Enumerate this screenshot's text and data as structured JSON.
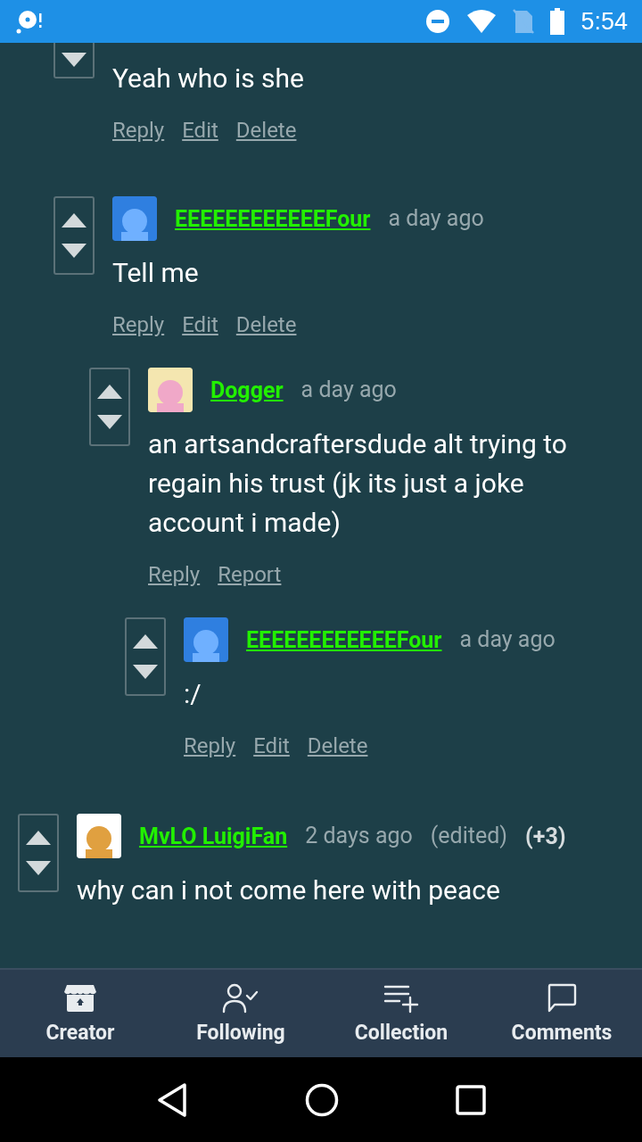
{
  "status_bar": {
    "time": "5:54"
  },
  "comments": [
    {
      "children": [
        {
          "cut_off": true,
          "body": "Yeah who is she",
          "actions": [
            "Reply",
            "Edit",
            "Delete"
          ]
        },
        {
          "author": "EEEEEEEEEEEEFour",
          "time": "a day ago",
          "body": "Tell me",
          "actions": [
            "Reply",
            "Edit",
            "Delete"
          ],
          "children": [
            {
              "author": "Dogger",
              "time": "a day ago",
              "body": "an artsandcraftersdude alt trying to regain his trust (jk its just a joke account i made)",
              "actions": [
                "Reply",
                "Report"
              ],
              "children": [
                {
                  "author": "EEEEEEEEEEEEFour",
                  "time": "a day ago",
                  "body": ":/",
                  "actions": [
                    "Reply",
                    "Edit",
                    "Delete"
                  ]
                }
              ]
            }
          ]
        }
      ]
    },
    {
      "author": "MvLO LuigiFan",
      "time": "2 days ago",
      "edited": "(edited)",
      "score": "(+3)",
      "body": "why can i not come here with peace"
    }
  ],
  "bottom_nav": [
    {
      "label": "Creator"
    },
    {
      "label": "Following"
    },
    {
      "label": "Collection"
    },
    {
      "label": "Comments"
    }
  ]
}
